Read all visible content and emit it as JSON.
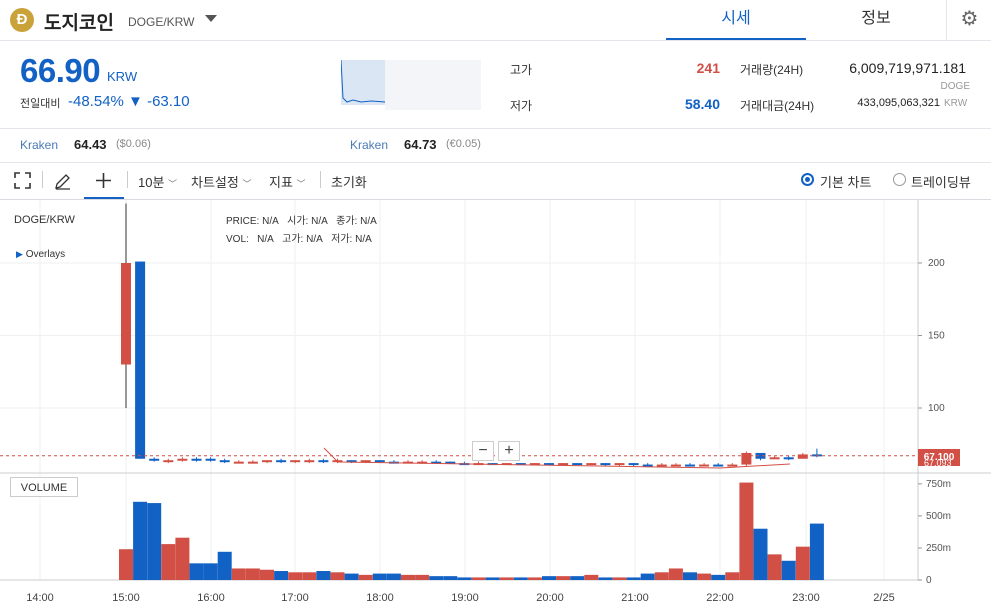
{
  "header": {
    "coin_icon_letter": "Đ",
    "coin_name": "도지코인",
    "coin_symbol": "DOGE/KRW",
    "tabs": [
      {
        "label": "시세",
        "active": true
      },
      {
        "label": "정보",
        "active": false
      }
    ]
  },
  "ticker": {
    "price": "66.90",
    "unit": "KRW",
    "change_label": "전일대비",
    "change_pct": "-48.54%",
    "change_arrow": "▼",
    "change_abs": "-63.10",
    "high_label": "고가",
    "high_value": "241",
    "low_label": "저가",
    "low_value": "58.40",
    "volume_label": "거래량(24H)",
    "volume_value": "6,009,719,971.181",
    "volume_unit": "DOGE",
    "amount_label": "거래대금(24H)",
    "amount_value": "433,095,063,321",
    "amount_unit": "KRW",
    "colors": {
      "up": "#d24f45",
      "down": "#1261c4"
    }
  },
  "exchanges": [
    {
      "name": "Kraken",
      "price": "64.43",
      "sub": "($0.06)"
    },
    {
      "name": "Kraken",
      "price": "64.73",
      "sub": "(€0.05)"
    }
  ],
  "toolbar": {
    "expand_icon": "expand-icon",
    "draw_icon": "pencil-icon",
    "crosshair_icon": "crosshair-icon",
    "interval": "10분",
    "chart_settings": "차트설정",
    "indicators": "지표",
    "reset": "초기화",
    "view_basic": "기본 차트",
    "view_tradingview": "트레이딩뷰",
    "selected_view": "basic"
  },
  "chart_data": {
    "type": "candlestick",
    "symbol_label": "DOGE/KRW",
    "overlays_label": "Overlays",
    "info": {
      "price_label": "PRICE:",
      "price": "N/A",
      "open_label": "시가:",
      "open": "N/A",
      "close_label": "종가:",
      "close": "N/A",
      "vol_label": "VOL:",
      "vol": "N/A",
      "high_label": "고가:",
      "high": "N/A",
      "low_label": "저가:",
      "low": "N/A"
    },
    "x_ticks": [
      "14:00",
      "15:00",
      "16:00",
      "17:00",
      "18:00",
      "19:00",
      "20:00",
      "21:00",
      "22:00",
      "23:00",
      "2/25"
    ],
    "y_ticks": [
      "200",
      "150",
      "100"
    ],
    "ylim": [
      62,
      241
    ],
    "last_price": "67.100",
    "last_price_sub": "67.093",
    "volume_label": "VOLUME",
    "volume_ticks": [
      "750m",
      "500m",
      "250m",
      "0"
    ],
    "volume_max_m": 780,
    "candles": [
      {
        "open": 130,
        "close": 200,
        "high": 241,
        "low": 100,
        "vol": 240
      },
      {
        "open": 201,
        "close": 65,
        "high": 201,
        "low": 65,
        "vol": 610
      },
      {
        "open": 65,
        "close": 64,
        "high": 66,
        "low": 63,
        "vol": 600
      },
      {
        "open": 63,
        "close": 64,
        "high": 65,
        "low": 62,
        "vol": 280
      },
      {
        "open": 64,
        "close": 65,
        "high": 66,
        "low": 63,
        "vol": 330
      },
      {
        "open": 65,
        "close": 64,
        "high": 66,
        "low": 63,
        "vol": 130
      },
      {
        "open": 65,
        "close": 64,
        "high": 66,
        "low": 63,
        "vol": 130
      },
      {
        "open": 64,
        "close": 63,
        "high": 65,
        "low": 62,
        "vol": 220
      },
      {
        "open": 62,
        "close": 63,
        "high": 64,
        "low": 62,
        "vol": 90
      },
      {
        "open": 62,
        "close": 63,
        "high": 64,
        "low": 62,
        "vol": 90
      },
      {
        "open": 63,
        "close": 64,
        "high": 64,
        "low": 62,
        "vol": 80
      },
      {
        "open": 64,
        "close": 63,
        "high": 65,
        "low": 62,
        "vol": 70
      },
      {
        "open": 63,
        "close": 64,
        "high": 64,
        "low": 62,
        "vol": 60
      },
      {
        "open": 63,
        "close": 64,
        "high": 65,
        "low": 62,
        "vol": 60
      },
      {
        "open": 64,
        "close": 63,
        "high": 65,
        "low": 62,
        "vol": 70
      },
      {
        "open": 63,
        "close": 64,
        "high": 65,
        "low": 62,
        "vol": 60
      },
      {
        "open": 64,
        "close": 63,
        "high": 64,
        "low": 62,
        "vol": 50
      },
      {
        "open": 63,
        "close": 64,
        "high": 64,
        "low": 62,
        "vol": 40
      },
      {
        "open": 64,
        "close": 63,
        "high": 64,
        "low": 62,
        "vol": 50
      },
      {
        "open": 63,
        "close": 62,
        "high": 64,
        "low": 62,
        "vol": 50
      },
      {
        "open": 62,
        "close": 63,
        "high": 64,
        "low": 62,
        "vol": 40
      },
      {
        "open": 62,
        "close": 63,
        "high": 64,
        "low": 62,
        "vol": 40
      },
      {
        "open": 63,
        "close": 62,
        "high": 64,
        "low": 62,
        "vol": 30
      },
      {
        "open": 63,
        "close": 62,
        "high": 63,
        "low": 62,
        "vol": 30
      },
      {
        "open": 62,
        "close": 61,
        "high": 63,
        "low": 61,
        "vol": 20
      },
      {
        "open": 61,
        "close": 62,
        "high": 63,
        "low": 61,
        "vol": 20
      },
      {
        "open": 62,
        "close": 61,
        "high": 62,
        "low": 61,
        "vol": 20
      },
      {
        "open": 61,
        "close": 62,
        "high": 62,
        "low": 61,
        "vol": 20
      },
      {
        "open": 62,
        "close": 61,
        "high": 62,
        "low": 61,
        "vol": 20
      },
      {
        "open": 61,
        "close": 62,
        "high": 62,
        "low": 61,
        "vol": 20
      },
      {
        "open": 62,
        "close": 61,
        "high": 62,
        "low": 61,
        "vol": 30
      },
      {
        "open": 61,
        "close": 62,
        "high": 62,
        "low": 61,
        "vol": 30
      },
      {
        "open": 62,
        "close": 61,
        "high": 62,
        "low": 61,
        "vol": 30
      },
      {
        "open": 61,
        "close": 62,
        "high": 62,
        "low": 61,
        "vol": 40
      },
      {
        "open": 62,
        "close": 61,
        "high": 62,
        "low": 60,
        "vol": 20
      },
      {
        "open": 61,
        "close": 62,
        "high": 62,
        "low": 60,
        "vol": 20
      },
      {
        "open": 62,
        "close": 61,
        "high": 62,
        "low": 60,
        "vol": 20
      },
      {
        "open": 61,
        "close": 60,
        "high": 62,
        "low": 60,
        "vol": 50
      },
      {
        "open": 60,
        "close": 61,
        "high": 62,
        "low": 60,
        "vol": 60
      },
      {
        "open": 60,
        "close": 61,
        "high": 62,
        "low": 60,
        "vol": 90
      },
      {
        "open": 61,
        "close": 60,
        "high": 62,
        "low": 60,
        "vol": 60
      },
      {
        "open": 60,
        "close": 61,
        "high": 62,
        "low": 60,
        "vol": 50
      },
      {
        "open": 61,
        "close": 60,
        "high": 62,
        "low": 60,
        "vol": 40
      },
      {
        "open": 60,
        "close": 61,
        "high": 62,
        "low": 60,
        "vol": 60
      },
      {
        "open": 61,
        "close": 69,
        "high": 70,
        "low": 60,
        "vol": 760
      },
      {
        "open": 69,
        "close": 65,
        "high": 69,
        "low": 64,
        "vol": 400
      },
      {
        "open": 65,
        "close": 66,
        "high": 67,
        "low": 65,
        "vol": 200
      },
      {
        "open": 66,
        "close": 65,
        "high": 67,
        "low": 64,
        "vol": 150
      },
      {
        "open": 65,
        "close": 68,
        "high": 69,
        "low": 65,
        "vol": 260
      },
      {
        "open": 68,
        "close": 67,
        "high": 72,
        "low": 66,
        "vol": 440
      }
    ]
  }
}
